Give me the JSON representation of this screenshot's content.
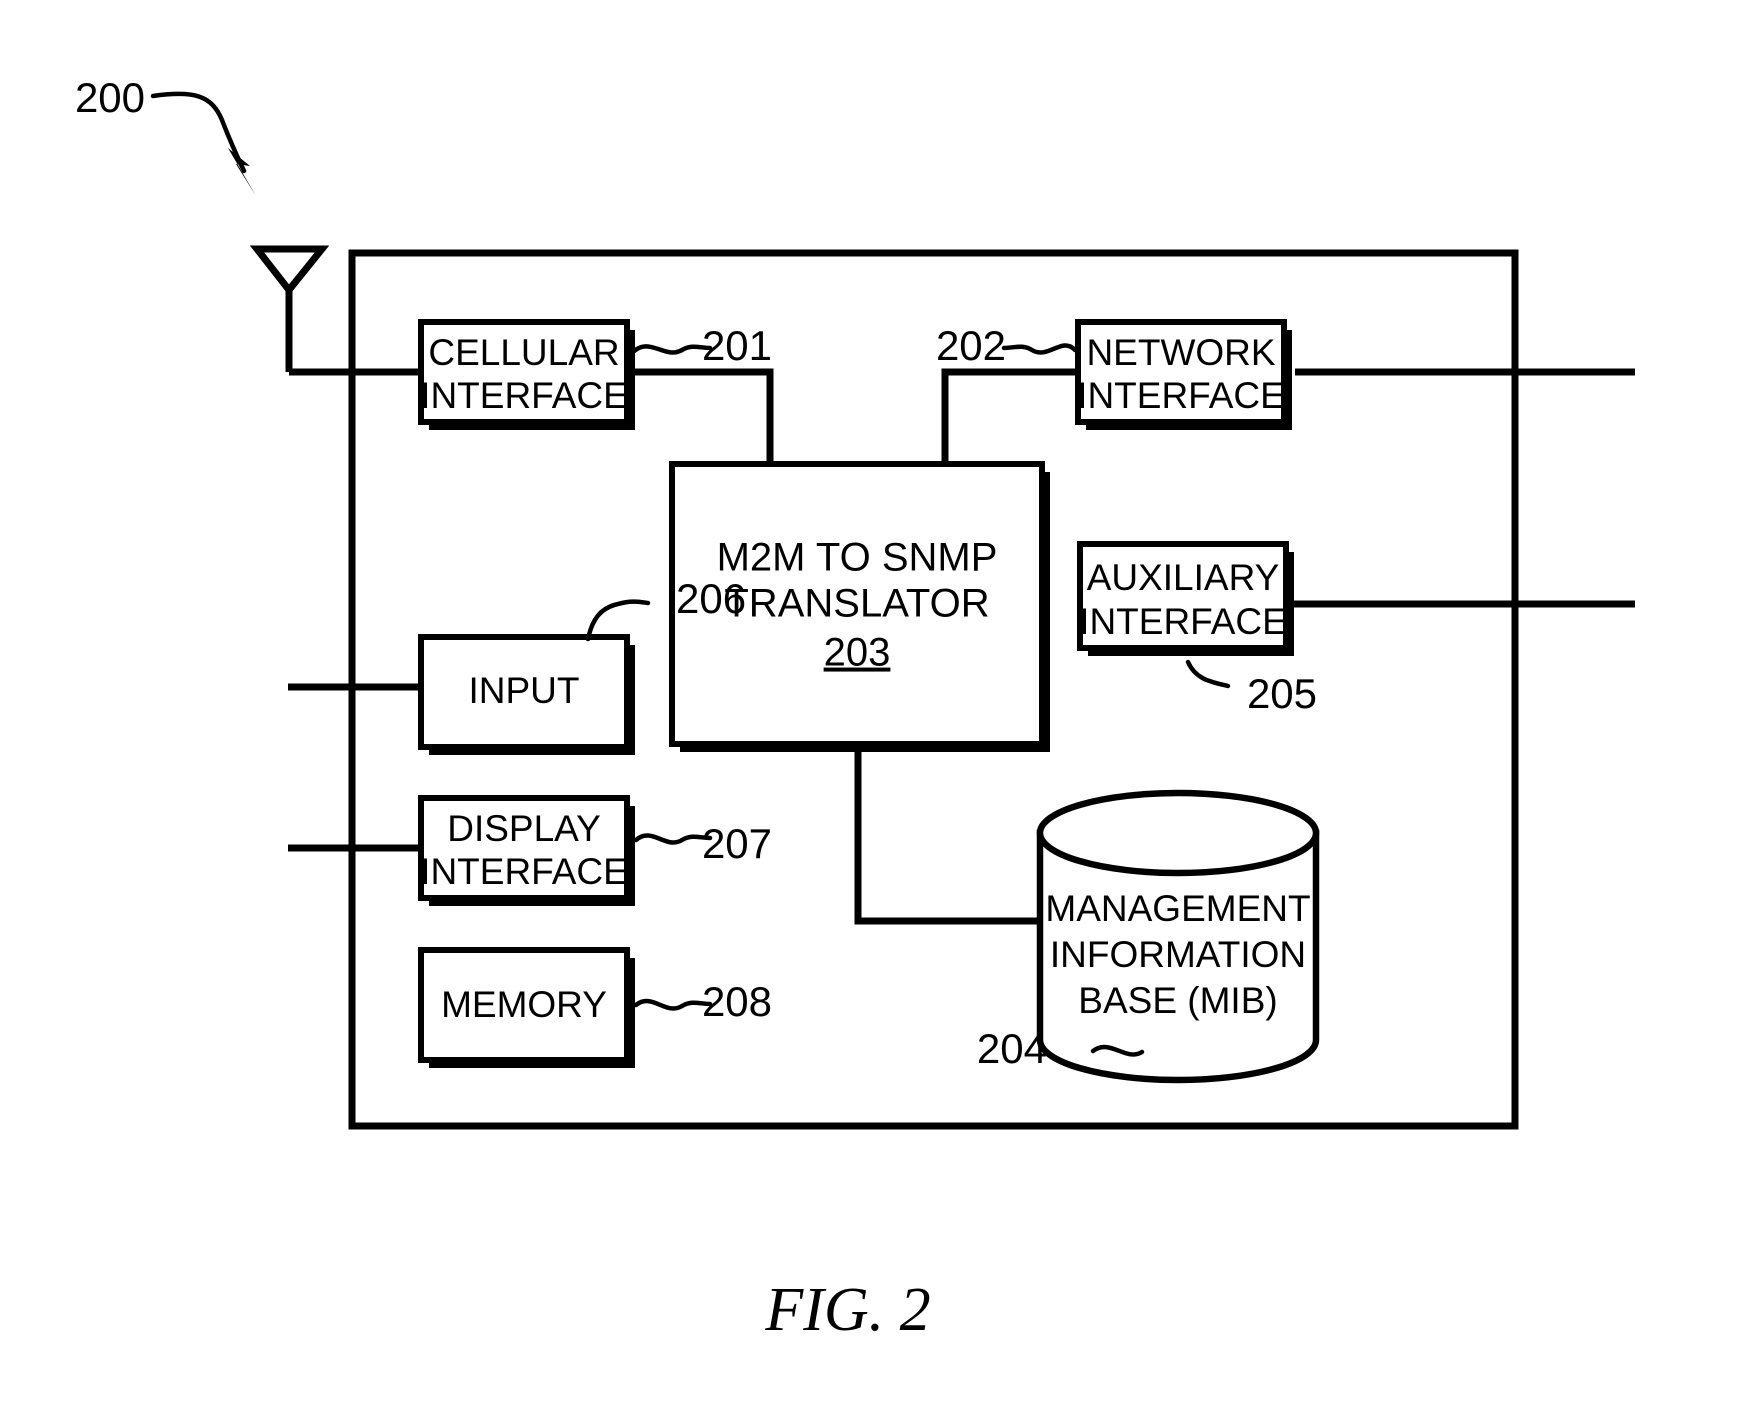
{
  "figure": {
    "caption": "FIG. 2",
    "system_ref": "200"
  },
  "blocks": [
    {
      "id": "cellular-interface",
      "lines": [
        "CELLULAR",
        "INTERFACE"
      ],
      "ref": "201"
    },
    {
      "id": "network-interface",
      "lines": [
        "NETWORK",
        "INTERFACE"
      ],
      "ref": "202"
    },
    {
      "id": "m2m-to-snmp-translator",
      "lines": [
        "M2M TO SNMP",
        "TRANSLATOR"
      ],
      "ref": "203",
      "ref_inside": true
    },
    {
      "id": "management-information-base",
      "lines": [
        "MANAGEMENT",
        "INFORMATION",
        "BASE (MIB)"
      ],
      "ref": "204",
      "shape": "cylinder"
    },
    {
      "id": "auxiliary-interface",
      "lines": [
        "AUXILIARY",
        "INTERFACE"
      ],
      "ref": "205"
    },
    {
      "id": "input",
      "lines": [
        "INPUT"
      ],
      "ref": "206"
    },
    {
      "id": "display-interface",
      "lines": [
        "DISPLAY",
        "INTERFACE"
      ],
      "ref": "207"
    },
    {
      "id": "memory",
      "lines": [
        "MEMORY"
      ],
      "ref": "208"
    }
  ],
  "icons": {
    "antenna": "antenna-icon",
    "arrow": "leader-arrow-icon"
  }
}
